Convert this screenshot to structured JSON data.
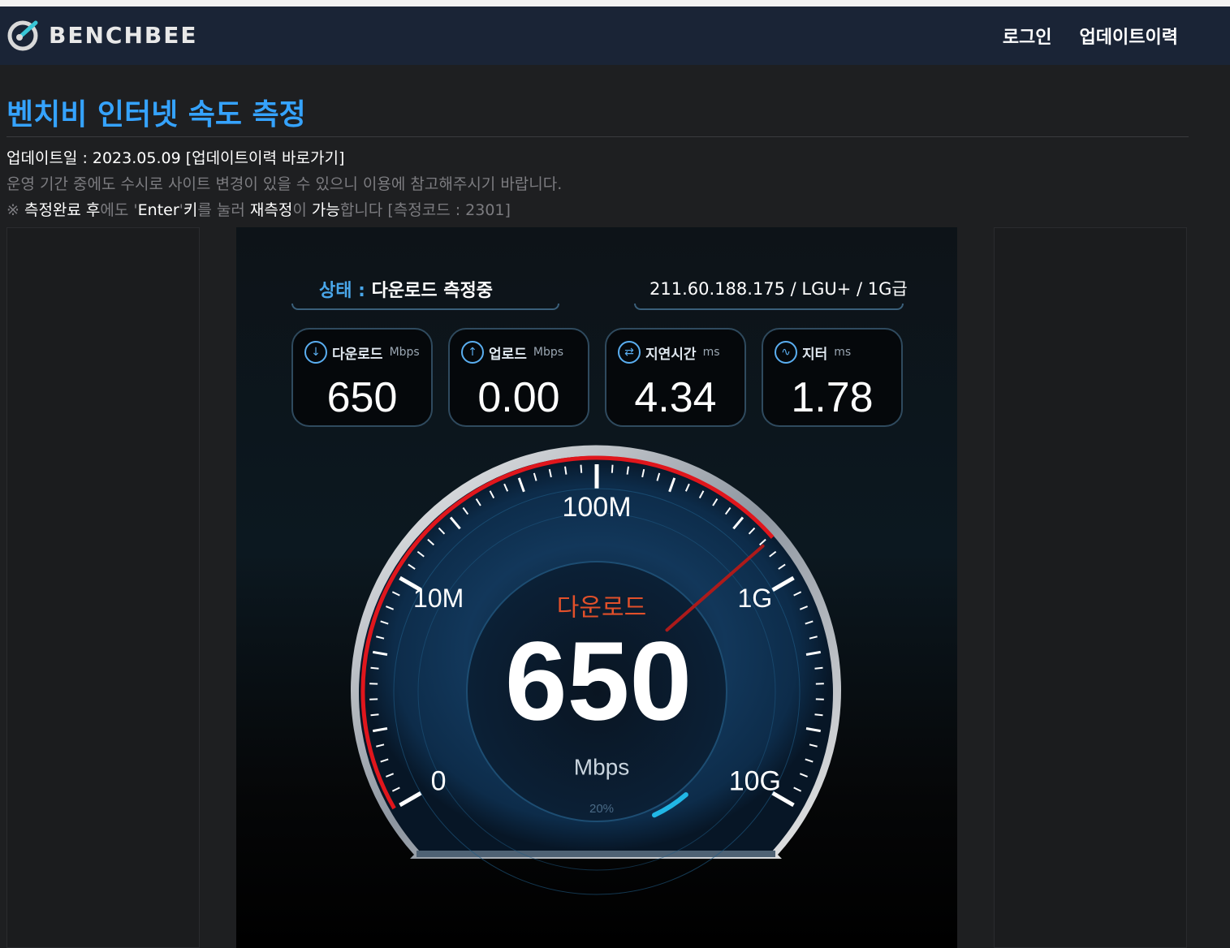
{
  "header": {
    "logo_text": "BENCHBEE",
    "nav": {
      "login": "로그인",
      "update_history": "업데이트이력"
    }
  },
  "page": {
    "title": "벤치비 인터넷 속도 측정",
    "update_line": "업데이트일 : 2023.05.09 [업데이트이력 바로가기]",
    "notice": "운영 기간 중에도 수시로 사이트 변경이 있을 수 있으니 이용에 참고해주시기 바랍니다.",
    "tip": {
      "mark": "※ ",
      "p1": "측정완료 후",
      "p2": "에도 '",
      "p3": "Enter",
      "p4": "'",
      "p5": "키",
      "p6": "를 눌러 ",
      "p7": "재측정",
      "p8": "이 ",
      "p9": "가능",
      "p10": "합니다 [측정코드 : 2301]"
    }
  },
  "speedtest": {
    "status_key": "상태 : ",
    "status_value": "다운로드 측정중",
    "server": "211.60.188.175 / LGU+ / 1G급",
    "cards": [
      {
        "label": "다운로드",
        "unit": "Mbps",
        "value": "650",
        "icon": "download-icon"
      },
      {
        "label": "업로드",
        "unit": "Mbps",
        "value": "0.00",
        "icon": "upload-icon"
      },
      {
        "label": "지연시간",
        "unit": "ms",
        "value": "4.34",
        "icon": "latency-icon"
      },
      {
        "label": "지터",
        "unit": "ms",
        "value": "1.78",
        "icon": "jitter-icon"
      }
    ],
    "gauge": {
      "mode_label": "다운로드",
      "value": "650",
      "unit": "Mbps",
      "progress_text": "20%",
      "progress": 0.2,
      "scale_labels": [
        "0",
        "10M",
        "100M",
        "1G",
        "10G"
      ]
    }
  },
  "colors": {
    "accent_blue": "#35a3ff",
    "gauge_red": "#e0161c",
    "progress_cyan": "#21b7e6"
  }
}
